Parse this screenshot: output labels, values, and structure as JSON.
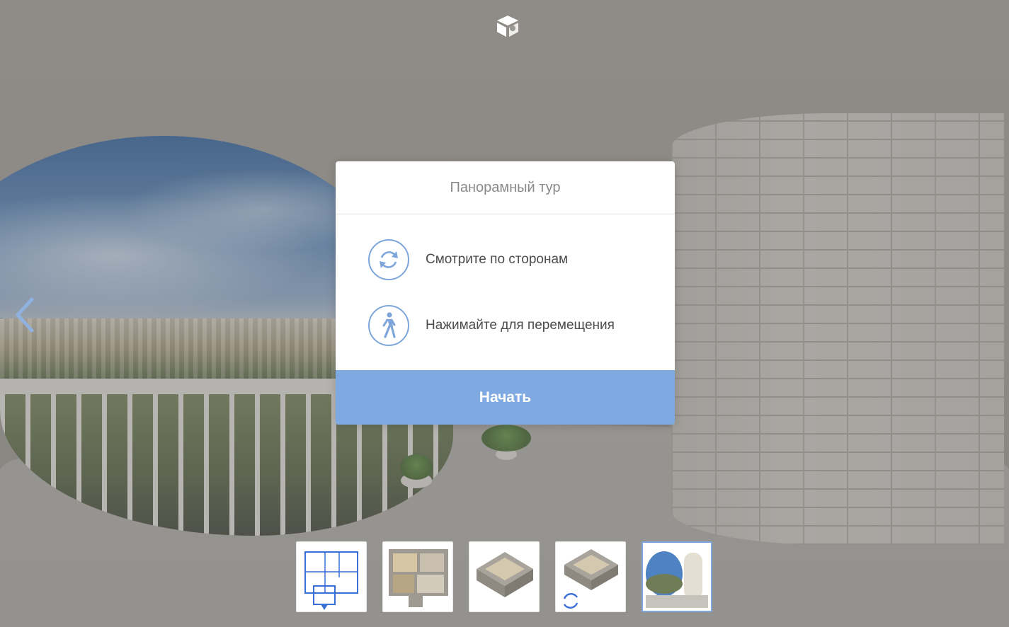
{
  "modal": {
    "title": "Панорамный тур",
    "hints": [
      {
        "icon": "rotate-icon",
        "label": "Смотрите по сторонам"
      },
      {
        "icon": "walking-person-icon",
        "label": "Нажимайте для перемещения"
      }
    ],
    "start_label": "Начать"
  },
  "nav": {
    "logo_icon": "cube-logo-icon",
    "prev_icon": "chevron-left-icon"
  },
  "thumbnails": [
    {
      "name": "floor-plan-2d",
      "active": false
    },
    {
      "name": "floor-plan-3d-top",
      "active": false
    },
    {
      "name": "floor-plan-3d-angle",
      "active": false
    },
    {
      "name": "floor-plan-3d-rotate",
      "active": false
    },
    {
      "name": "panorama-balcony",
      "active": true
    }
  ],
  "colors": {
    "accent": "#7eaae1",
    "icon_stroke": "#7ea6da",
    "title_text": "#8a8a8a",
    "body_text": "#4b4b4b"
  }
}
